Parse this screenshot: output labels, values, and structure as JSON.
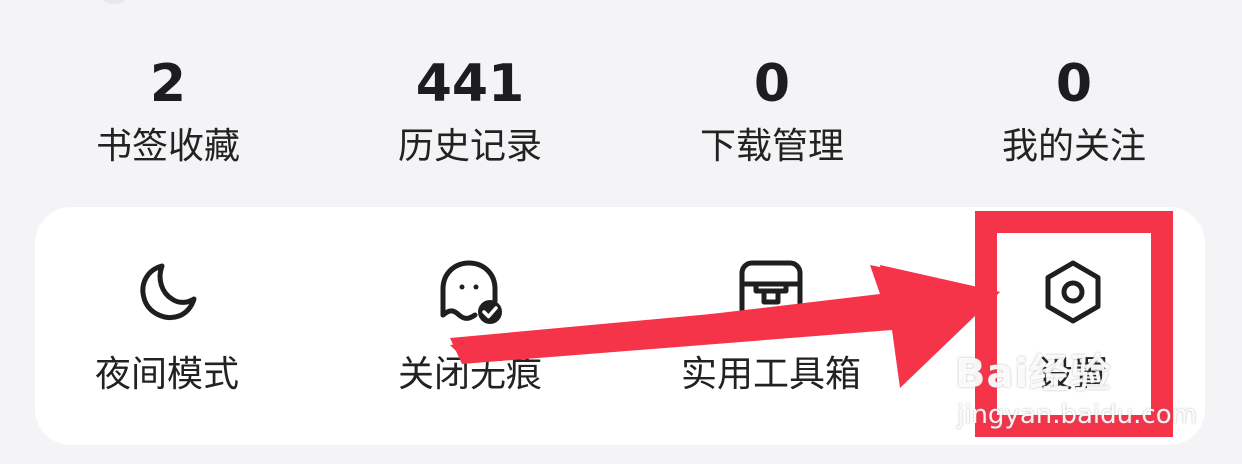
{
  "stats": [
    {
      "value": "2",
      "label": "书签收藏"
    },
    {
      "value": "441",
      "label": "历史记录"
    },
    {
      "value": "0",
      "label": "下载管理"
    },
    {
      "value": "0",
      "label": "我的关注"
    }
  ],
  "tools": [
    {
      "icon": "moon-icon",
      "label": "夜间模式"
    },
    {
      "icon": "ghost-check-icon",
      "label": "关闭无痕"
    },
    {
      "icon": "toolbox-icon",
      "label": "实用工具箱"
    },
    {
      "icon": "settings-hexagon-icon",
      "label": "设置"
    }
  ],
  "annotation": {
    "color": "#f5344a",
    "highlight_target": "设置"
  },
  "watermark": {
    "brand": "Bai经验",
    "url": "jingyan.baidu.com"
  },
  "colors": {
    "background": "#f4f4f6",
    "card": "#ffffff",
    "text": "#1f1f1f",
    "icon_stroke": "#1f1f1f",
    "annotation_red": "#f5344a"
  }
}
